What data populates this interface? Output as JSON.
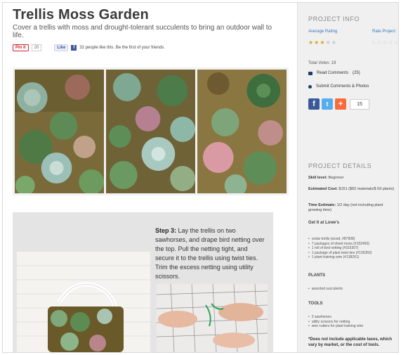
{
  "article": {
    "title": "Trellis Moss Garden",
    "subtitle": "Cover a trellis with moss and drought-tolerant succulents to bring an outdoor wall to life."
  },
  "social": {
    "pin_label": "Pin it",
    "pin_count": "20",
    "like_label": "Like",
    "like_text": "32 people like this. Be the first of your friends."
  },
  "step": {
    "heading": "Step 3:",
    "text": "Lay the trellis on two sawhorses, and drape bird netting over the top. Pull the netting tight, and secure it to the trellis using twist ties. Trim the excess netting using utility scissors."
  },
  "sidebar": {
    "project_info_heading": "PROJECT INFO",
    "average_rating_label": "Average Rating",
    "rate_project_label": "Rate Project",
    "average_rating_stars": 3,
    "max_stars": 5,
    "total_votes": "Total Votes: 19",
    "read_comments": "Read Comments",
    "comments_count": "(25)",
    "submit_comments": "Submit Comments & Photos",
    "share_count": "15",
    "project_details_heading": "PROJECT DETAILS",
    "skill_level_label": "Skill level:",
    "skill_level_value": "Beginner",
    "estimated_cost_label": "Estimated Cost:",
    "estimated_cost_value": "$151 ($82 materials/$ 69 plants)",
    "time_estimate_label": "Time Estimate:",
    "time_estimate_value": "1/2 day (not including plant growing time)",
    "get_it_heading": "Get It at Lowe's",
    "materials": [
      "cedar trellis (wood, #87908)",
      "7 packages of sheet moss (#152450)",
      "1 roll of bird netting (#316307)",
      "1 package of plant twist ties (#136350)",
      "1 plant training wire (#138261)"
    ],
    "plants_heading": "PLANTS",
    "plants": [
      "assorted succulents"
    ],
    "tools_heading": "TOOLS",
    "tools": [
      "2 sawhorses",
      "utility scissors for netting",
      "wire cutters for plant training wire"
    ],
    "footnote": "*Does not include applicable taxes, which vary by market, or the cost of tools."
  },
  "colors": {
    "rating_star": "#d9a521",
    "link_blue": "#3a78b8",
    "facebook": "#3b5998",
    "twitter": "#55acee",
    "addthis": "#f86c3c"
  },
  "icons": {
    "comments": "chat-icon",
    "submit": "bullet-icon",
    "facebook": "facebook-icon",
    "twitter": "twitter-icon",
    "addthis": "plus-icon"
  }
}
